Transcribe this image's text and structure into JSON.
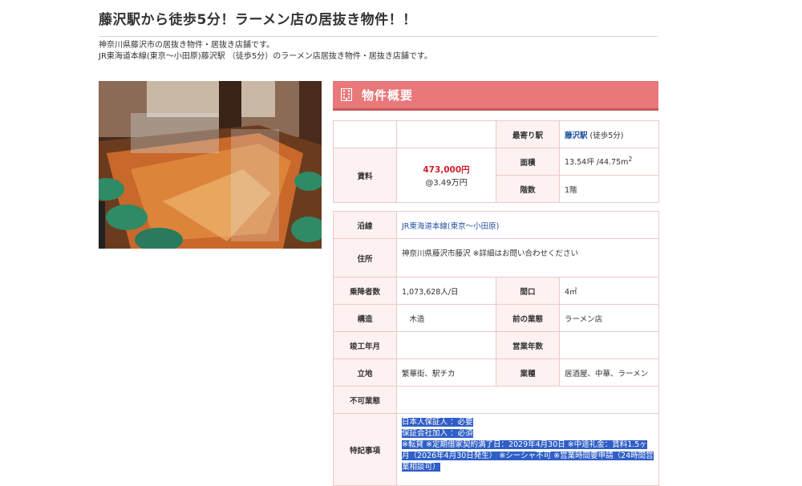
{
  "page": {
    "title": "藤沢駅から徒歩5分！ラーメン店の居抜き物件！！",
    "intro_lines": [
      "神奈川県藤沢市の居抜き物件・居抜き店舗です。",
      "JR東海道本線(東京～小田原)藤沢駅 （徒歩5分）のラーメン店居抜き物件・居抜き店舗です。"
    ]
  },
  "photo": {
    "alt": "ラーメン店の店内（カウンター席）"
  },
  "section": {
    "title": "物件概要",
    "icon": "building-icon"
  },
  "summary": {
    "rent_label": "賃料",
    "rent_price": "473,000円",
    "rent_per_tsubo": "@3.49万円",
    "nearest_station_label": "最寄り駅",
    "nearest_station_name": "藤沢駅",
    "nearest_station_walk": " (徒歩5分)",
    "area_label": "面積",
    "area_value": "13.54坪 /44.75m",
    "area_sup": "2",
    "floor_label": "階数",
    "floor_value": "1階"
  },
  "details": {
    "line_label": "沿線",
    "line_value": "JR東海道本線(東京～小田原)",
    "address_label": "住所",
    "address_value": "神奈川県藤沢市藤沢 ※詳細はお問い合わせください",
    "passengers_label": "乗降者数",
    "passengers_value": "1,073,628人/日",
    "frontage_label": "間口",
    "frontage_value": "4㎡",
    "structure_label": "構造",
    "structure_value": "　木造",
    "prev_business_label": "前の業態",
    "prev_business_value": "ラーメン店",
    "built_label": "竣工年月",
    "built_value": "",
    "years_label": "営業年数",
    "years_value": "",
    "location_label": "立地",
    "location_value": "繁華街、駅チカ",
    "category_label": "業種",
    "category_value": "居酒屋、中華、ラーメン",
    "prohibited_label": "不可業態",
    "prohibited_value": "",
    "notes_label": "特記事項",
    "notes_lines": [
      "日本人保証人 ：必要",
      "保証会社加入 ：必須",
      "※転貸 ※定期借家契約満了日：2029年4月30日 ※中途礼金：賃料1.5ヶ",
      "月（2026年4月30日発生） ※シーシャ不可 ※営業時間要申請（24時間営",
      "業相談可）"
    ]
  },
  "colors": {
    "header_bg": "#e8787a",
    "label_bg": "#fdf1f1",
    "border": "#f0c8c8",
    "price_red": "#d0202a",
    "link_blue": "#1f4f9e",
    "highlight": "#2f5fc7"
  }
}
